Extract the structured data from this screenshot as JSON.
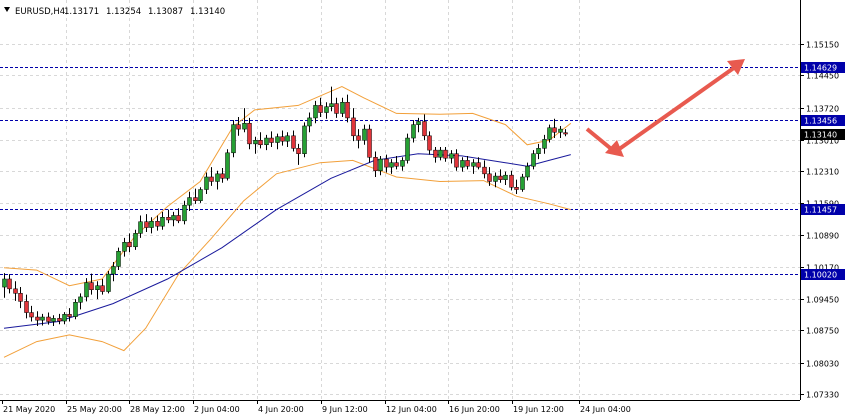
{
  "header": {
    "menu_arrow": "dropdown-arrow",
    "symbol": "EURUSD,H4",
    "ohlc": [
      "1.13171",
      "1.13254",
      "1.13087",
      "1.13140"
    ]
  },
  "colors": {
    "bull": "#26a034",
    "bear": "#e0343a",
    "bands": "#f2a03a",
    "ma": "#1a1a9c",
    "level_line": "#0000aa",
    "level_tag": "#0000aa",
    "price_tag": "#000000",
    "grid": "#d8d8d8",
    "arrow": "#e85a4f"
  },
  "chart_data": {
    "type": "candlestick",
    "symbol": "EURUSD",
    "timeframe": "H4",
    "x_labels": [
      "21 May 2020",
      "25 May 20:00",
      "28 May 12:00",
      "2 Jun 04:00",
      "4 Jun 20:00",
      "9 Jun 12:00",
      "12 Jun 04:00",
      "16 Jun 20:00",
      "19 Jun 12:00",
      "24 Jun 04:00"
    ],
    "y_ticks": [
      "1.15150",
      "1.14450",
      "1.13720",
      "1.13010",
      "1.12310",
      "1.11590",
      "1.10890",
      "1.10170",
      "1.09450",
      "1.08750",
      "1.08030",
      "1.07330"
    ],
    "ylim": [
      1.0733,
      1.1542
    ],
    "grid": true,
    "horizontal_levels": [
      {
        "label": "1.14629",
        "value": 1.14629
      },
      {
        "label": "1.13456",
        "value": 1.13456
      },
      {
        "label": "1.11457",
        "value": 1.11457
      },
      {
        "label": "1.10020",
        "value": 1.1002
      }
    ],
    "current_price": {
      "label": "1.13140",
      "value": 1.1314
    },
    "candles": [
      {
        "o": 1.0972,
        "h": 1.1003,
        "l": 1.0948,
        "c": 1.099
      },
      {
        "o": 1.099,
        "h": 1.1001,
        "l": 1.0958,
        "c": 1.0968
      },
      {
        "o": 1.0968,
        "h": 1.0985,
        "l": 1.0941,
        "c": 1.0958
      },
      {
        "o": 1.0958,
        "h": 1.0972,
        "l": 1.0925,
        "c": 1.094
      },
      {
        "o": 1.094,
        "h": 1.0955,
        "l": 1.0902,
        "c": 1.0915
      },
      {
        "o": 1.0915,
        "h": 1.093,
        "l": 1.0895,
        "c": 1.0905
      },
      {
        "o": 1.0905,
        "h": 1.0918,
        "l": 1.0885,
        "c": 1.0898
      },
      {
        "o": 1.0898,
        "h": 1.0912,
        "l": 1.0886,
        "c": 1.0905
      },
      {
        "o": 1.0905,
        "h": 1.0915,
        "l": 1.0888,
        "c": 1.0895
      },
      {
        "o": 1.0895,
        "h": 1.0909,
        "l": 1.0885,
        "c": 1.0902
      },
      {
        "o": 1.0902,
        "h": 1.0912,
        "l": 1.0889,
        "c": 1.0896
      },
      {
        "o": 1.0896,
        "h": 1.0916,
        "l": 1.0889,
        "c": 1.0911
      },
      {
        "o": 1.0911,
        "h": 1.0925,
        "l": 1.0895,
        "c": 1.0906
      },
      {
        "o": 1.0906,
        "h": 1.0945,
        "l": 1.09,
        "c": 1.0938
      },
      {
        "o": 1.0938,
        "h": 1.0958,
        "l": 1.0922,
        "c": 1.095
      },
      {
        "o": 1.095,
        "h": 1.0992,
        "l": 1.094,
        "c": 1.0982
      },
      {
        "o": 1.0982,
        "h": 1.1002,
        "l": 1.0955,
        "c": 1.0966
      },
      {
        "o": 1.0966,
        "h": 1.0985,
        "l": 1.0945,
        "c": 1.0975
      },
      {
        "o": 1.0975,
        "h": 1.099,
        "l": 1.0955,
        "c": 1.0962
      },
      {
        "o": 1.0962,
        "h": 1.1008,
        "l": 1.0958,
        "c": 1.1001
      },
      {
        "o": 1.1001,
        "h": 1.1028,
        "l": 1.0985,
        "c": 1.1018
      },
      {
        "o": 1.1018,
        "h": 1.106,
        "l": 1.101,
        "c": 1.1052
      },
      {
        "o": 1.1052,
        "h": 1.1082,
        "l": 1.104,
        "c": 1.1072
      },
      {
        "o": 1.1072,
        "h": 1.1092,
        "l": 1.105,
        "c": 1.1062
      },
      {
        "o": 1.1062,
        "h": 1.11,
        "l": 1.1055,
        "c": 1.1092
      },
      {
        "o": 1.1092,
        "h": 1.1132,
        "l": 1.1082,
        "c": 1.1118
      },
      {
        "o": 1.1118,
        "h": 1.1135,
        "l": 1.1095,
        "c": 1.1105
      },
      {
        "o": 1.1105,
        "h": 1.1128,
        "l": 1.1092,
        "c": 1.1119
      },
      {
        "o": 1.1119,
        "h": 1.1132,
        "l": 1.1098,
        "c": 1.1108
      },
      {
        "o": 1.1108,
        "h": 1.114,
        "l": 1.11,
        "c": 1.1128
      },
      {
        "o": 1.1128,
        "h": 1.1145,
        "l": 1.1115,
        "c": 1.1122
      },
      {
        "o": 1.1122,
        "h": 1.114,
        "l": 1.1108,
        "c": 1.1132
      },
      {
        "o": 1.1132,
        "h": 1.1148,
        "l": 1.1115,
        "c": 1.112
      },
      {
        "o": 1.112,
        "h": 1.1165,
        "l": 1.1112,
        "c": 1.1155
      },
      {
        "o": 1.1155,
        "h": 1.1185,
        "l": 1.1142,
        "c": 1.1172
      },
      {
        "o": 1.1172,
        "h": 1.1192,
        "l": 1.1158,
        "c": 1.1165
      },
      {
        "o": 1.1165,
        "h": 1.1195,
        "l": 1.116,
        "c": 1.119
      },
      {
        "o": 1.119,
        "h": 1.1228,
        "l": 1.118,
        "c": 1.1218
      },
      {
        "o": 1.1218,
        "h": 1.124,
        "l": 1.1198,
        "c": 1.1208
      },
      {
        "o": 1.1208,
        "h": 1.1232,
        "l": 1.119,
        "c": 1.1225
      },
      {
        "o": 1.1225,
        "h": 1.1238,
        "l": 1.1205,
        "c": 1.1215
      },
      {
        "o": 1.1215,
        "h": 1.128,
        "l": 1.121,
        "c": 1.1272
      },
      {
        "o": 1.1272,
        "h": 1.1345,
        "l": 1.1262,
        "c": 1.1335
      },
      {
        "o": 1.1335,
        "h": 1.1352,
        "l": 1.131,
        "c": 1.1325
      },
      {
        "o": 1.1325,
        "h": 1.1372,
        "l": 1.1318,
        "c": 1.1338
      },
      {
        "o": 1.1338,
        "h": 1.135,
        "l": 1.128,
        "c": 1.1292
      },
      {
        "o": 1.1292,
        "h": 1.1308,
        "l": 1.127,
        "c": 1.13
      },
      {
        "o": 1.13,
        "h": 1.1318,
        "l": 1.1282,
        "c": 1.129
      },
      {
        "o": 1.129,
        "h": 1.1312,
        "l": 1.1278,
        "c": 1.1305
      },
      {
        "o": 1.1305,
        "h": 1.132,
        "l": 1.1285,
        "c": 1.1295
      },
      {
        "o": 1.1295,
        "h": 1.1315,
        "l": 1.128,
        "c": 1.1308
      },
      {
        "o": 1.1308,
        "h": 1.1322,
        "l": 1.1288,
        "c": 1.1298
      },
      {
        "o": 1.1298,
        "h": 1.1318,
        "l": 1.1285,
        "c": 1.131
      },
      {
        "o": 1.131,
        "h": 1.1322,
        "l": 1.1275,
        "c": 1.1282
      },
      {
        "o": 1.1282,
        "h": 1.1292,
        "l": 1.1245,
        "c": 1.127
      },
      {
        "o": 1.127,
        "h": 1.134,
        "l": 1.1262,
        "c": 1.1332
      },
      {
        "o": 1.1332,
        "h": 1.1362,
        "l": 1.1318,
        "c": 1.135
      },
      {
        "o": 1.135,
        "h": 1.1388,
        "l": 1.1338,
        "c": 1.1378
      },
      {
        "o": 1.1378,
        "h": 1.1395,
        "l": 1.1352,
        "c": 1.1362
      },
      {
        "o": 1.1362,
        "h": 1.1385,
        "l": 1.1348,
        "c": 1.1375
      },
      {
        "o": 1.1375,
        "h": 1.142,
        "l": 1.1365,
        "c": 1.1382
      },
      {
        "o": 1.1382,
        "h": 1.1395,
        "l": 1.135,
        "c": 1.136
      },
      {
        "o": 1.136,
        "h": 1.1395,
        "l": 1.1352,
        "c": 1.1385
      },
      {
        "o": 1.1385,
        "h": 1.1402,
        "l": 1.134,
        "c": 1.135
      },
      {
        "o": 1.135,
        "h": 1.1372,
        "l": 1.1298,
        "c": 1.131
      },
      {
        "o": 1.131,
        "h": 1.1325,
        "l": 1.1282,
        "c": 1.13
      },
      {
        "o": 1.13,
        "h": 1.1335,
        "l": 1.129,
        "c": 1.1325
      },
      {
        "o": 1.1325,
        "h": 1.1335,
        "l": 1.125,
        "c": 1.1262
      },
      {
        "o": 1.1262,
        "h": 1.1275,
        "l": 1.1218,
        "c": 1.1232
      },
      {
        "o": 1.1232,
        "h": 1.1265,
        "l": 1.1222,
        "c": 1.1258
      },
      {
        "o": 1.1258,
        "h": 1.1268,
        "l": 1.1228,
        "c": 1.124
      },
      {
        "o": 1.124,
        "h": 1.1258,
        "l": 1.1225,
        "c": 1.125
      },
      {
        "o": 1.125,
        "h": 1.1265,
        "l": 1.1235,
        "c": 1.1242
      },
      {
        "o": 1.1242,
        "h": 1.1262,
        "l": 1.1232,
        "c": 1.1255
      },
      {
        "o": 1.1255,
        "h": 1.1315,
        "l": 1.1248,
        "c": 1.1305
      },
      {
        "o": 1.1305,
        "h": 1.1345,
        "l": 1.1295,
        "c": 1.1335
      },
      {
        "o": 1.1335,
        "h": 1.135,
        "l": 1.1318,
        "c": 1.1342
      },
      {
        "o": 1.1342,
        "h": 1.1358,
        "l": 1.13,
        "c": 1.131
      },
      {
        "o": 1.131,
        "h": 1.132,
        "l": 1.1268,
        "c": 1.1278
      },
      {
        "o": 1.1278,
        "h": 1.1285,
        "l": 1.125,
        "c": 1.1262
      },
      {
        "o": 1.1262,
        "h": 1.1285,
        "l": 1.1255,
        "c": 1.1278
      },
      {
        "o": 1.1278,
        "h": 1.1285,
        "l": 1.1252,
        "c": 1.126
      },
      {
        "o": 1.126,
        "h": 1.1278,
        "l": 1.1248,
        "c": 1.127
      },
      {
        "o": 1.127,
        "h": 1.128,
        "l": 1.1232,
        "c": 1.124
      },
      {
        "o": 1.124,
        "h": 1.1262,
        "l": 1.123,
        "c": 1.1255
      },
      {
        "o": 1.1255,
        "h": 1.1265,
        "l": 1.1235,
        "c": 1.1242
      },
      {
        "o": 1.1242,
        "h": 1.1258,
        "l": 1.1225,
        "c": 1.125
      },
      {
        "o": 1.125,
        "h": 1.1262,
        "l": 1.1235,
        "c": 1.124
      },
      {
        "o": 1.124,
        "h": 1.1255,
        "l": 1.1215,
        "c": 1.1225
      },
      {
        "o": 1.1225,
        "h": 1.124,
        "l": 1.1198,
        "c": 1.1208
      },
      {
        "o": 1.1208,
        "h": 1.1228,
        "l": 1.1195,
        "c": 1.122
      },
      {
        "o": 1.122,
        "h": 1.1235,
        "l": 1.1205,
        "c": 1.1212
      },
      {
        "o": 1.1212,
        "h": 1.123,
        "l": 1.12,
        "c": 1.1222
      },
      {
        "o": 1.1222,
        "h": 1.1232,
        "l": 1.1188,
        "c": 1.1195
      },
      {
        "o": 1.1195,
        "h": 1.1212,
        "l": 1.118,
        "c": 1.119
      },
      {
        "o": 1.119,
        "h": 1.1225,
        "l": 1.1185,
        "c": 1.1218
      },
      {
        "o": 1.1218,
        "h": 1.125,
        "l": 1.121,
        "c": 1.1242
      },
      {
        "o": 1.1242,
        "h": 1.1278,
        "l": 1.1235,
        "c": 1.127
      },
      {
        "o": 1.127,
        "h": 1.1292,
        "l": 1.1258,
        "c": 1.1282
      },
      {
        "o": 1.1282,
        "h": 1.1312,
        "l": 1.127,
        "c": 1.1302
      },
      {
        "o": 1.1302,
        "h": 1.1335,
        "l": 1.1295,
        "c": 1.1328
      },
      {
        "o": 1.1328,
        "h": 1.1348,
        "l": 1.1305,
        "c": 1.1318
      },
      {
        "o": 1.1318,
        "h": 1.1332,
        "l": 1.1305,
        "c": 1.1325
      },
      {
        "o": 1.1317,
        "h": 1.1325,
        "l": 1.1309,
        "c": 1.1314
      }
    ],
    "moving_average": [
      [
        0,
        1.088
      ],
      [
        10,
        1.0895
      ],
      [
        20,
        1.0935
      ],
      [
        30,
        1.099
      ],
      [
        40,
        1.106
      ],
      [
        50,
        1.1145
      ],
      [
        60,
        1.1215
      ],
      [
        68,
        1.1255
      ],
      [
        76,
        1.127
      ],
      [
        84,
        1.1265
      ],
      [
        92,
        1.125
      ],
      [
        96,
        1.1242
      ],
      [
        100,
        1.1255
      ],
      [
        104,
        1.1268
      ]
    ],
    "bollinger_upper": [
      [
        0,
        1.1015
      ],
      [
        6,
        1.101
      ],
      [
        12,
        1.0975
      ],
      [
        18,
        1.099
      ],
      [
        24,
        1.1085
      ],
      [
        30,
        1.1152
      ],
      [
        36,
        1.1208
      ],
      [
        42,
        1.133
      ],
      [
        46,
        1.1368
      ],
      [
        54,
        1.1378
      ],
      [
        62,
        1.142
      ],
      [
        66,
        1.1395
      ],
      [
        72,
        1.136
      ],
      [
        80,
        1.1358
      ],
      [
        86,
        1.136
      ],
      [
        92,
        1.1335
      ],
      [
        96,
        1.129
      ],
      [
        100,
        1.13
      ],
      [
        104,
        1.1338
      ]
    ],
    "bollinger_lower": [
      [
        0,
        1.0815
      ],
      [
        6,
        1.085
      ],
      [
        12,
        1.0865
      ],
      [
        18,
        1.085
      ],
      [
        22,
        1.083
      ],
      [
        26,
        1.088
      ],
      [
        32,
        1.1
      ],
      [
        38,
        1.108
      ],
      [
        44,
        1.1165
      ],
      [
        50,
        1.1225
      ],
      [
        58,
        1.125
      ],
      [
        64,
        1.1255
      ],
      [
        72,
        1.1218
      ],
      [
        80,
        1.1208
      ],
      [
        88,
        1.121
      ],
      [
        94,
        1.1175
      ],
      [
        100,
        1.1158
      ],
      [
        104,
        1.1145
      ]
    ]
  }
}
